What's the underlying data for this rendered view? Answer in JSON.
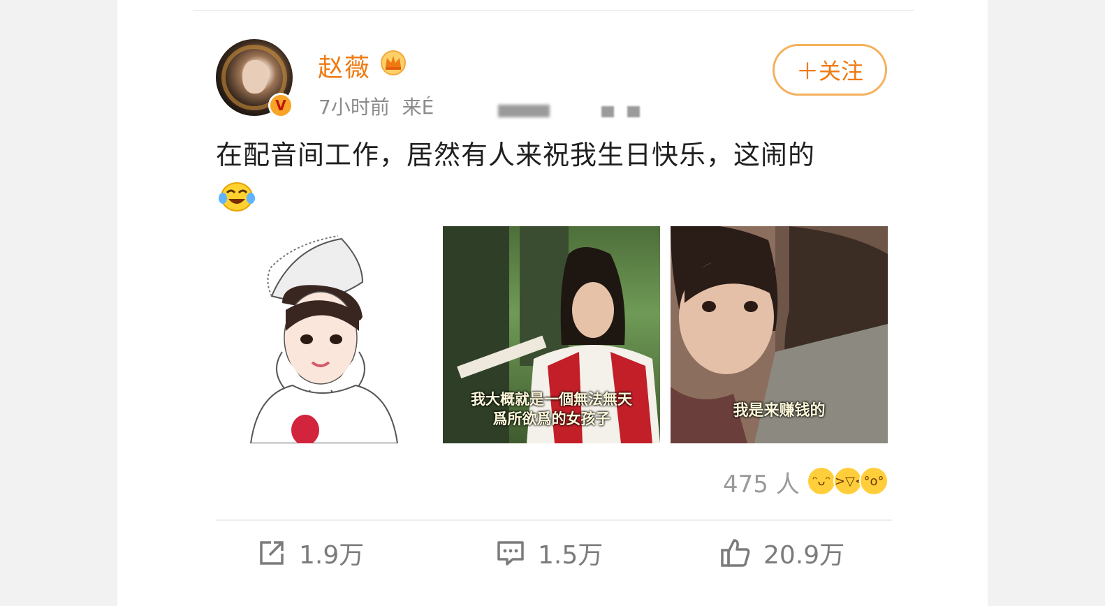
{
  "post": {
    "username": "赵薇",
    "meta_time": "7小时前",
    "meta_source_partial": "来É",
    "follow_label": "＋关注",
    "text": "在配音间工作，居然有人来祝我生日快乐，这闹的"
  },
  "images": [
    {
      "caption": ""
    },
    {
      "caption_line1": "我大概就是一個無法無天",
      "caption_line2": "爲所欲爲的女孩子"
    },
    {
      "caption": "我是来赚钱的"
    }
  ],
  "reactions": {
    "count_label": "475 人"
  },
  "actions": {
    "repost": "1.9万",
    "comment": "1.5万",
    "like": "20.9万"
  },
  "colors": {
    "accent": "#f07a12",
    "follow_border": "#f5b15d",
    "meta": "#8b8b8b"
  }
}
